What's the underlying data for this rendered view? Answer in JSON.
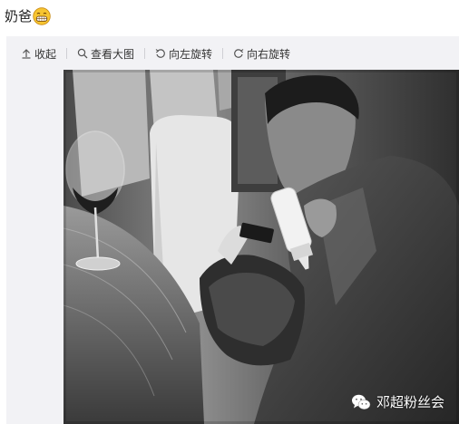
{
  "post": {
    "text": "奶爸",
    "emoji_icon": "grinning-face-emoji"
  },
  "toolbar": {
    "collapse_label": "收起",
    "view_large_label": "查看大图",
    "rotate_left_label": "向左旋转",
    "rotate_right_label": "向右旋转"
  },
  "photo": {
    "watermark_text": "邓超粉丝会",
    "watermark_icon": "wechat-icon"
  }
}
